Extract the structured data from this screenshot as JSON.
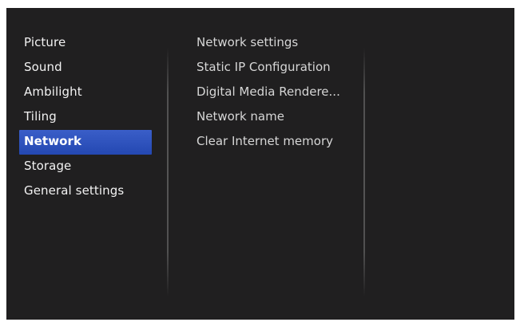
{
  "main_menu": {
    "items": [
      {
        "label": "Picture",
        "selected": false
      },
      {
        "label": "Sound",
        "selected": false
      },
      {
        "label": "Ambilight",
        "selected": false
      },
      {
        "label": "Tiling",
        "selected": false
      },
      {
        "label": "Network",
        "selected": true
      },
      {
        "label": "Storage",
        "selected": false
      },
      {
        "label": "General settings",
        "selected": false
      }
    ]
  },
  "sub_menu": {
    "items": [
      {
        "label": "Network settings"
      },
      {
        "label": "Static IP Configuration"
      },
      {
        "label": "Digital Media Rendere..."
      },
      {
        "label": "Network name"
      },
      {
        "label": "Clear Internet memory"
      }
    ]
  },
  "colors": {
    "screen_background": "#201f20",
    "selection_highlight": "#2a4fba",
    "text": "#f2f2f2"
  }
}
